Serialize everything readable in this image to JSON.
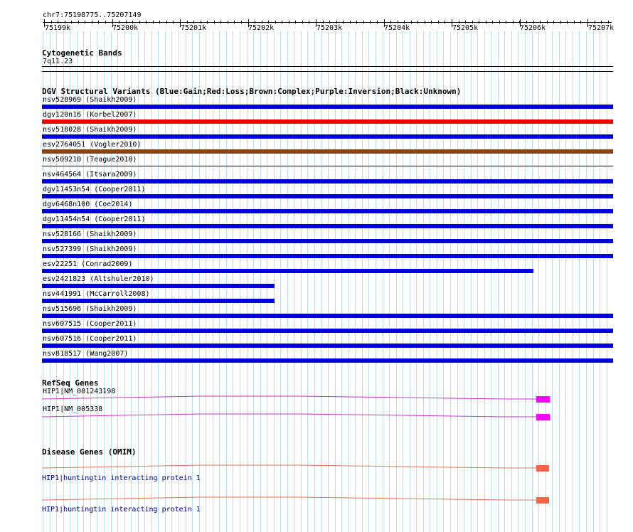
{
  "ruler": {
    "position": "chr7:75198775..75207149",
    "ticks": [
      "75199k",
      "75200k",
      "75201k",
      "75202k",
      "75203k",
      "75204k",
      "75205k",
      "75206k",
      "75207k"
    ]
  },
  "cytobands": {
    "title": "Cytogenetic Bands",
    "band": "7q11.23"
  },
  "dgv": {
    "title": "DGV Structural Variants (Blue:Gain;Red:Loss;Brown:Complex;Purple:Inversion;Black:Unknown)",
    "colors": {
      "gain": "#0000dd",
      "loss": "#ee0000",
      "complex": "#8b4513",
      "unknown": "#000000"
    },
    "variants": [
      {
        "label": "nsv528969 (Shaikh2009)",
        "type": "gain"
      },
      {
        "label": "dgv120n16 (Korbel2007)",
        "type": "loss"
      },
      {
        "label": "nsv518028 (Shaikh2009)",
        "type": "gain"
      },
      {
        "label": "esv2764051 (Vogler2010)",
        "type": "complex"
      },
      {
        "label": "nsv509210 (Teague2010)",
        "type": "unknown"
      },
      {
        "label": "nsv464564 (Itsara2009)",
        "type": "gain"
      },
      {
        "label": "dgv11453n54 (Cooper2011)",
        "type": "gain"
      },
      {
        "label": "dgv6468n100 (Coe2014)",
        "type": "gain"
      },
      {
        "label": "dgv11454n54 (Cooper2011)",
        "type": "gain"
      },
      {
        "label": "nsv528166 (Shaikh2009)",
        "type": "gain"
      },
      {
        "label": "nsv527399 (Shaikh2009)",
        "type": "gain"
      },
      {
        "label": "esv22251 (Conrad2009)",
        "type": "gain"
      },
      {
        "label": "esv2421823 (Altshuler2010)",
        "type": "gain"
      },
      {
        "label": "nsv441991 (McCarroll2008)",
        "type": "gain"
      },
      {
        "label": "nsv515696 (Shaikh2009)",
        "type": "gain"
      },
      {
        "label": "nsv607515 (Cooper2011)",
        "type": "gain"
      },
      {
        "label": "nsv607516 (Cooper2011)",
        "type": "gain"
      },
      {
        "label": "nsv818517 (Wang2007)",
        "type": "gain"
      }
    ]
  },
  "refseq": {
    "title": "RefSeq Genes",
    "genes": [
      {
        "label": "HIP1|NM_001243198"
      },
      {
        "label": "HIP1|NM_005338"
      }
    ],
    "color": "#ff00ff"
  },
  "omim": {
    "title": "Disease Genes (OMIM)",
    "genes": [
      {
        "label": "HIP1|huntingtin interacting protein 1"
      },
      {
        "label": "HIP1|huntingtin interacting protein 1"
      }
    ],
    "color": "#ff6347"
  }
}
